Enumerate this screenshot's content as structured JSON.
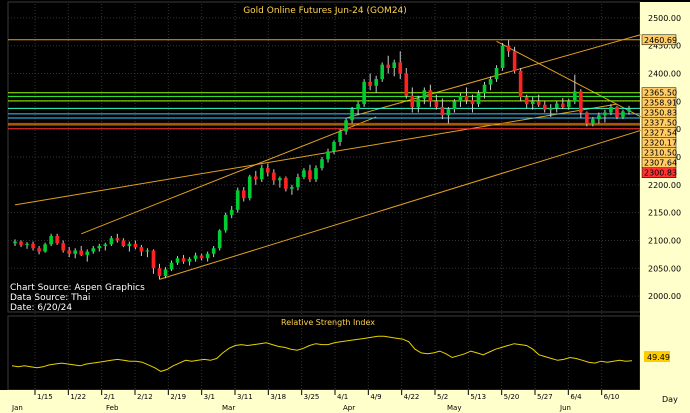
{
  "chart_data": [
    {
      "type": "candlestick",
      "title": "Gold Online Futures Jun-24 (GOM24)",
      "ylim": [
        1975,
        2525
      ],
      "y_ticks": [
        2000,
        2050,
        2100,
        2150,
        2200,
        2250,
        2300,
        2350,
        2400,
        2450,
        2500
      ],
      "y_tick_labels": [
        "2000.00",
        "2050.00",
        "2100.00",
        "2150.00",
        "2200.00",
        "2250.00",
        "2300.00",
        "2350.00",
        "2400.00",
        "2450.00",
        "2500.00"
      ],
      "series": [
        {
          "ohlc": [
            [
              2095,
              2102,
              2090,
              2098
            ],
            [
              2098,
              2100,
              2088,
              2092
            ],
            [
              2092,
              2097,
              2085,
              2094
            ],
            [
              2094,
              2098,
              2082,
              2086
            ],
            [
              2086,
              2090,
              2075,
              2080
            ],
            [
              2080,
              2096,
              2078,
              2093
            ],
            [
              2093,
              2112,
              2090,
              2108
            ],
            [
              2108,
              2112,
              2092,
              2095
            ],
            [
              2095,
              2100,
              2078,
              2082
            ],
            [
              2082,
              2088,
              2070,
              2076
            ],
            [
              2076,
              2086,
              2068,
              2082
            ],
            [
              2082,
              2090,
              2072,
              2074
            ],
            [
              2074,
              2084,
              2062,
              2080
            ],
            [
              2080,
              2090,
              2076,
              2086
            ],
            [
              2086,
              2094,
              2080,
              2090
            ],
            [
              2090,
              2096,
              2082,
              2093
            ],
            [
              2093,
              2108,
              2090,
              2104
            ],
            [
              2104,
              2112,
              2096,
              2100
            ],
            [
              2100,
              2104,
              2088,
              2090
            ],
            [
              2090,
              2098,
              2080,
              2094
            ],
            [
              2094,
              2100,
              2084,
              2088
            ],
            [
              2088,
              2092,
              2072,
              2080
            ],
            [
              2080,
              2086,
              2070,
              2082
            ],
            [
              2082,
              2084,
              2040,
              2050
            ],
            [
              2050,
              2058,
              2030,
              2036
            ],
            [
              2036,
              2052,
              2032,
              2048
            ],
            [
              2048,
              2064,
              2045,
              2060
            ],
            [
              2060,
              2072,
              2056,
              2068
            ],
            [
              2068,
              2074,
              2058,
              2062
            ],
            [
              2062,
              2070,
              2055,
              2067
            ],
            [
              2067,
              2078,
              2062,
              2073
            ],
            [
              2073,
              2076,
              2064,
              2068
            ],
            [
              2068,
              2080,
              2062,
              2076
            ],
            [
              2076,
              2090,
              2070,
              2086
            ],
            [
              2086,
              2120,
              2082,
              2118
            ],
            [
              2118,
              2150,
              2114,
              2146
            ],
            [
              2146,
              2162,
              2140,
              2155
            ],
            [
              2155,
              2195,
              2150,
              2190
            ],
            [
              2190,
              2196,
              2170,
              2176
            ],
            [
              2176,
              2218,
              2172,
              2215
            ],
            [
              2215,
              2225,
              2200,
              2210
            ],
            [
              2210,
              2236,
              2205,
              2230
            ],
            [
              2230,
              2238,
              2215,
              2222
            ],
            [
              2222,
              2228,
              2200,
              2208
            ],
            [
              2208,
              2215,
              2195,
              2212
            ],
            [
              2212,
              2215,
              2188,
              2193
            ],
            [
              2193,
              2200,
              2182,
              2196
            ],
            [
              2196,
              2220,
              2190,
              2214
            ],
            [
              2214,
              2230,
              2210,
              2226
            ],
            [
              2226,
              2236,
              2205,
              2210
            ],
            [
              2210,
              2235,
              2205,
              2230
            ],
            [
              2230,
              2250,
              2226,
              2246
            ],
            [
              2246,
              2265,
              2240,
              2260
            ],
            [
              2260,
              2280,
              2255,
              2277
            ],
            [
              2277,
              2300,
              2270,
              2296
            ],
            [
              2296,
              2320,
              2290,
              2316
            ],
            [
              2316,
              2340,
              2310,
              2336
            ],
            [
              2336,
              2350,
              2325,
              2345
            ],
            [
              2345,
              2390,
              2340,
              2385
            ],
            [
              2385,
              2400,
              2370,
              2378
            ],
            [
              2378,
              2396,
              2365,
              2390
            ],
            [
              2390,
              2420,
              2385,
              2416
            ],
            [
              2416,
              2432,
              2400,
              2410
            ],
            [
              2410,
              2425,
              2395,
              2420
            ],
            [
              2420,
              2440,
              2390,
              2400
            ],
            [
              2400,
              2410,
              2355,
              2360
            ],
            [
              2360,
              2375,
              2330,
              2340
            ],
            [
              2340,
              2360,
              2330,
              2355
            ],
            [
              2355,
              2375,
              2345,
              2370
            ],
            [
              2370,
              2380,
              2340,
              2350
            ],
            [
              2350,
              2362,
              2335,
              2340
            ],
            [
              2340,
              2355,
              2318,
              2325
            ],
            [
              2325,
              2340,
              2310,
              2336
            ],
            [
              2336,
              2354,
              2330,
              2350
            ],
            [
              2350,
              2365,
              2340,
              2360
            ],
            [
              2360,
              2375,
              2345,
              2352
            ],
            [
              2352,
              2362,
              2330,
              2345
            ],
            [
              2345,
              2370,
              2340,
              2365
            ],
            [
              2365,
              2385,
              2355,
              2380
            ],
            [
              2380,
              2395,
              2370,
              2390
            ],
            [
              2390,
              2415,
              2385,
              2410
            ],
            [
              2410,
              2455,
              2405,
              2450
            ],
            [
              2450,
              2460,
              2430,
              2440
            ],
            [
              2440,
              2448,
              2400,
              2405
            ],
            [
              2405,
              2410,
              2350,
              2358
            ],
            [
              2358,
              2362,
              2338,
              2345
            ],
            [
              2345,
              2358,
              2335,
              2350
            ],
            [
              2350,
              2362,
              2340,
              2344
            ],
            [
              2344,
              2350,
              2330,
              2335
            ],
            [
              2335,
              2345,
              2322,
              2338
            ],
            [
              2338,
              2350,
              2330,
              2346
            ],
            [
              2346,
              2356,
              2336,
              2340
            ],
            [
              2340,
              2355,
              2335,
              2350
            ],
            [
              2350,
              2398,
              2345,
              2368
            ],
            [
              2368,
              2372,
              2320,
              2330
            ],
            [
              2330,
              2332,
              2305,
              2310
            ],
            [
              2310,
              2322,
              2305,
              2318
            ],
            [
              2318,
              2330,
              2310,
              2325
            ],
            [
              2325,
              2335,
              2312,
              2330
            ],
            [
              2330,
              2345,
              2325,
              2340
            ],
            [
              2340,
              2342,
              2318,
              2322
            ],
            [
              2322,
              2335,
              2318,
              2332
            ],
            [
              2332,
              2342,
              2326,
              2336
            ]
          ]
        }
      ],
      "horizontal_levels": [
        {
          "value": 2460.69,
          "label": "2460.69",
          "color": "#ff9900",
          "box_bg": "#ffcc66"
        },
        {
          "value": 2365.5,
          "label": "2365.50",
          "color": "#99ff00",
          "box_bg": "#ffcc66"
        },
        {
          "value": 2358.91,
          "label": "2358.91",
          "color": "#33ff33",
          "box_bg": "#ffcc66"
        },
        {
          "value": 2350.83,
          "label": "2350.83",
          "color": "#99ff00",
          "box_bg": "#ffcc66"
        },
        {
          "value": 2337.5,
          "label": "2337.50",
          "color": "#33ffcc",
          "box_bg": "#ffcc66"
        },
        {
          "value": 2327.54,
          "label": "2327.54",
          "color": "#33ccff",
          "box_bg": "#ffcc66"
        },
        {
          "value": 2320.17,
          "label": "2320.17",
          "color": "#33ccff",
          "box_bg": "#ffcc66"
        },
        {
          "value": 2310.5,
          "label": "2310.50",
          "color": "#ff3333",
          "box_bg": "#ffcc66"
        },
        {
          "value": 2307.64,
          "label": "2307.64",
          "color": "#ff9900",
          "box_bg": "#ffcc66"
        },
        {
          "value": 2300.83,
          "label": "2300.83",
          "color": "#ff3333",
          "box_bg": "#ff3333"
        }
      ],
      "trendlines_value_space": [
        {
          "x0": 0,
          "y0": 2164,
          "x1": 100,
          "y1": 2345
        },
        {
          "x0": 24,
          "y0": 2030,
          "x1": 104,
          "y1": 2298
        },
        {
          "x0": 11,
          "y0": 2112,
          "x1": 60,
          "y1": 2322
        },
        {
          "x0": 55,
          "y0": 2320,
          "x1": 104,
          "y1": 2470
        },
        {
          "x0": 80,
          "y0": 2458,
          "x1": 104,
          "y1": 2322
        }
      ],
      "annotations": [
        "Chart Source: Aspen Graphics",
        "Data Source: Thai",
        "Date: 6/20/24"
      ],
      "colors": {
        "up": "#00cc33",
        "down": "#ff2222",
        "wick": "#cccccc",
        "trend": "#e0a020",
        "axis_bg": "#ffffcc",
        "grid": "#333333"
      }
    },
    {
      "type": "line",
      "title": "Relative Strength Index",
      "last_value_label": "49.49",
      "values": [
        44,
        43,
        44,
        43,
        42,
        43,
        45,
        46,
        47,
        46,
        45,
        44,
        46,
        47,
        48,
        49,
        50,
        51,
        50,
        49,
        49,
        48,
        45,
        42,
        38,
        40,
        44,
        47,
        50,
        49,
        50,
        51,
        50,
        52,
        58,
        63,
        66,
        67,
        66,
        67,
        68,
        69,
        67,
        65,
        64,
        62,
        61,
        63,
        66,
        68,
        67,
        67,
        69,
        70,
        71,
        72,
        73,
        74,
        75,
        76,
        76,
        75,
        74,
        73,
        70,
        62,
        58,
        57,
        58,
        60,
        57,
        53,
        55,
        57,
        60,
        58,
        56,
        59,
        62,
        64,
        66,
        68,
        67,
        66,
        62,
        56,
        54,
        52,
        50,
        51,
        53,
        52,
        50,
        48,
        47,
        49,
        48,
        49,
        50,
        49,
        49.49
      ],
      "colors": {
        "line": "#e6d200",
        "box_bg": "#ffcc00"
      }
    }
  ],
  "x_axis": {
    "labels": [
      "1/15",
      "1/22",
      "2/1",
      "2/12",
      "2/19",
      "3/1",
      "3/11",
      "3/18",
      "3/25",
      "4/1",
      "4/9",
      "4/22",
      "5/2",
      "5/13",
      "5/20",
      "5/27",
      "6/4",
      "6/10"
    ],
    "months": [
      "Jan",
      "Feb",
      "Mar",
      "Apr",
      "May",
      "Jun"
    ],
    "corner_label": "Day"
  }
}
